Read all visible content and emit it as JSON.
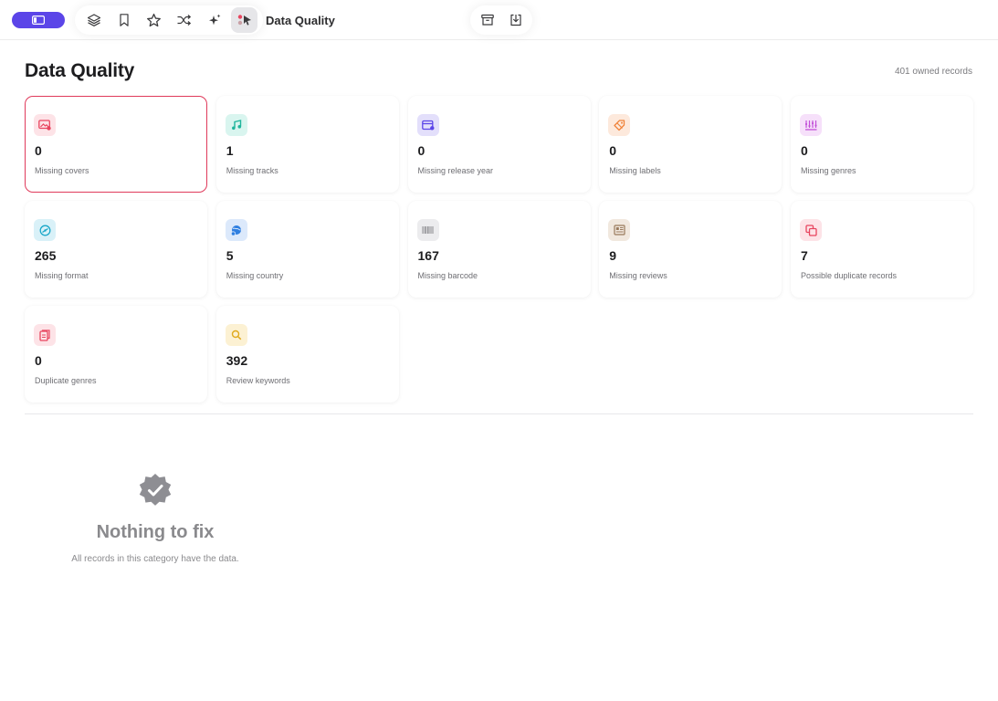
{
  "topbar": {
    "title": "Data Quality",
    "tools": [
      {
        "name": "layers-icon"
      },
      {
        "name": "bookmark-icon"
      },
      {
        "name": "star-icon"
      },
      {
        "name": "shuffle-icon"
      },
      {
        "name": "sparkle-icon"
      },
      {
        "name": "data-quality-icon",
        "active": true
      }
    ],
    "actions": [
      {
        "name": "archive-icon"
      },
      {
        "name": "download-icon"
      }
    ]
  },
  "page": {
    "title": "Data Quality",
    "owned_records": "401 owned records"
  },
  "cards": [
    {
      "id": "missing-covers",
      "value": "0",
      "label": "Missing covers",
      "icon": "image-icon",
      "color": "#e8455f",
      "bg": "#fde3e7",
      "selected": true
    },
    {
      "id": "missing-tracks",
      "value": "1",
      "label": "Missing tracks",
      "icon": "music-note-icon",
      "color": "#1fb59c",
      "bg": "#d9f5ef"
    },
    {
      "id": "missing-release-year",
      "value": "0",
      "label": "Missing release year",
      "icon": "calendar-icon",
      "color": "#5b45e8",
      "bg": "#e3dffb"
    },
    {
      "id": "missing-labels",
      "value": "0",
      "label": "Missing labels",
      "icon": "tag-icon",
      "color": "#f0843c",
      "bg": "#fde9dc"
    },
    {
      "id": "missing-genres",
      "value": "0",
      "label": "Missing genres",
      "icon": "genres-icon",
      "color": "#c24fd8",
      "bg": "#f6e0fa"
    },
    {
      "id": "missing-format",
      "value": "265",
      "label": "Missing format",
      "icon": "disc-icon",
      "color": "#1aa8c9",
      "bg": "#d9f1f8"
    },
    {
      "id": "missing-country",
      "value": "5",
      "label": "Missing country",
      "icon": "globe-icon",
      "color": "#2f7fe0",
      "bg": "#dce9fb"
    },
    {
      "id": "missing-barcode",
      "value": "167",
      "label": "Missing barcode",
      "icon": "barcode-icon",
      "color": "#8c8c90",
      "bg": "#ececee"
    },
    {
      "id": "missing-reviews",
      "value": "9",
      "label": "Missing reviews",
      "icon": "review-icon",
      "color": "#9a7a5c",
      "bg": "#f1e8de"
    },
    {
      "id": "possible-duplicate-records",
      "value": "7",
      "label": "Possible duplicate records",
      "icon": "duplicate-icon",
      "color": "#e8455f",
      "bg": "#fde3e7"
    },
    {
      "id": "duplicate-genres",
      "value": "0",
      "label": "Duplicate genres",
      "icon": "copy-genre-icon",
      "color": "#e8455f",
      "bg": "#fde3e7"
    },
    {
      "id": "review-keywords",
      "value": "392",
      "label": "Review keywords",
      "icon": "search-icon",
      "color": "#e0a91a",
      "bg": "#fcf1d3"
    }
  ],
  "empty_state": {
    "icon": "verified-badge-icon",
    "title": "Nothing to fix",
    "subtitle": "All records in this category have the data."
  },
  "colors": {
    "accent": "#5b45e8",
    "selected_border": "#e03a5b",
    "muted_text": "#8a8a8d"
  }
}
